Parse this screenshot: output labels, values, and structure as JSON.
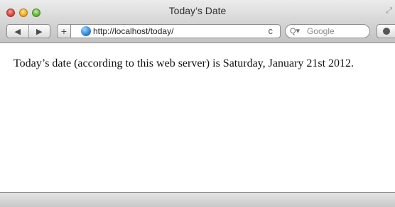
{
  "window": {
    "title": "Today’s Date"
  },
  "toolbar": {
    "back_icon": "◀",
    "forward_icon": "▶",
    "add_icon": "+",
    "url": "http://localhost/today/",
    "reload_icon": "c",
    "search_icon": "Q▾",
    "search_placeholder": "Google"
  },
  "page": {
    "text": "Today’s date (according to this web server) is Saturday, January 21st 2012."
  }
}
